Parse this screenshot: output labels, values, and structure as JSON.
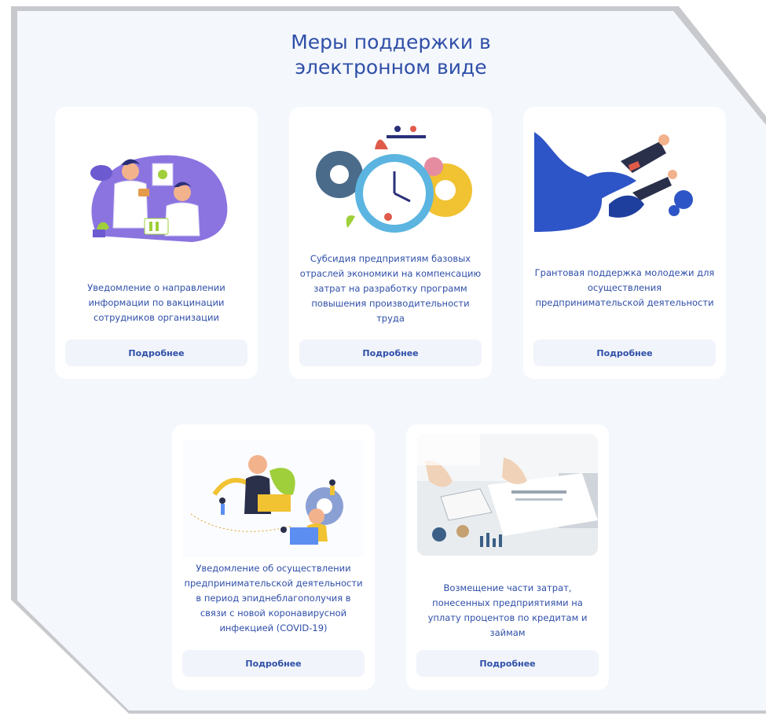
{
  "page": {
    "title_line1": "Меры поддержки в",
    "title_line2": "электронном виде"
  },
  "cards": [
    {
      "text": "Уведомление о направлении информации по вакцинации сотрудников организации",
      "button": "Подробнее",
      "illustration": "scientists-lab-illustration"
    },
    {
      "text": "Субсидия предприятиям базовых отраслей экономики на компенсацию затрат на разработку программ повышения производительности труда",
      "button": "Подробнее",
      "illustration": "gears-clock-illustration"
    },
    {
      "text": "Грантовая поддержка молодежи для осуществления предпринимательской деятельности",
      "button": "Подробнее",
      "illustration": "flying-businesspeople-illustration"
    },
    {
      "text": "Уведомление об осуществлении предпринимательской деятельности в период эпиднеблагополучия в связи с новой коронавирусной инфекцией (COVID-19)",
      "button": "Подробнее",
      "illustration": "office-team-illustration"
    },
    {
      "text": "Возмещение части затрат, понесенных предприятиями на уплату процентов по кредитам и займам",
      "button": "Подробнее",
      "illustration": "calculator-documents-photo"
    }
  ],
  "colors": {
    "accent": "#2f4fa8",
    "page_background": "#f4f7fc",
    "button_background": "#f1f4fa",
    "card_background": "#ffffff"
  }
}
